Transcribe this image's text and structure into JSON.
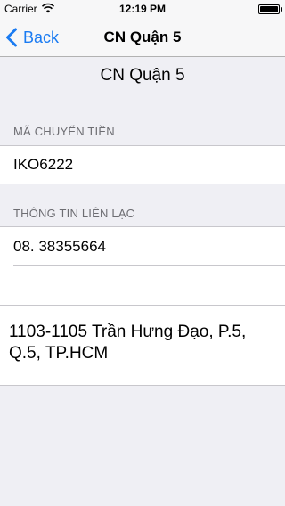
{
  "status_bar": {
    "carrier": "Carrier",
    "time": "12:19 PM"
  },
  "nav": {
    "back_label": "Back",
    "title": "CN Quận 5"
  },
  "page_title": "CN Quận 5",
  "transfer_section": {
    "header": "MÃ CHUYỂN TIỀN",
    "code": "IKO6222"
  },
  "contact_section": {
    "header": "THÔNG TIN LIÊN LẠC",
    "phone": "08. 38355664",
    "empty_row": ""
  },
  "address": "1103-1105 Trần Hưng Đạo, P.5, Q.5, TP.HCM",
  "colors": {
    "accent": "#1a7bf2",
    "background": "#efeff4"
  }
}
